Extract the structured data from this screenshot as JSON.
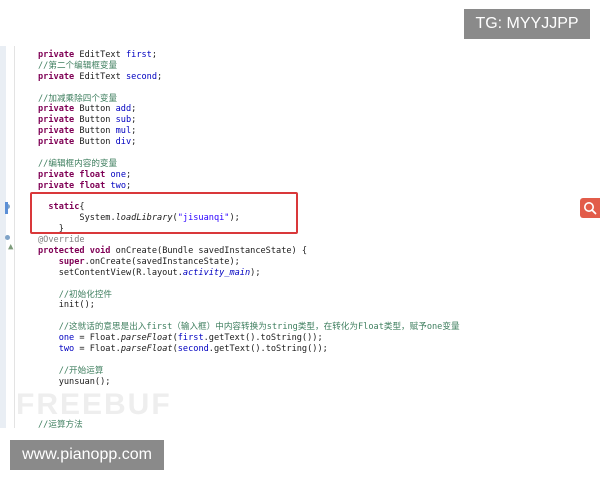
{
  "watermark_tg": "TG: MYYJJPP",
  "watermark_site": "www.pianopp.com",
  "watermark_logo": "FREEBUF",
  "colors": {
    "keyword": "#7f0055",
    "comment": "#3f7f5f",
    "field": "#0000c0",
    "string": "#2a00ff",
    "highlight_box": "#d9383a"
  },
  "code": {
    "l1": {
      "kw": "private",
      "type": " EditText ",
      "field": "first",
      "end": ";"
    },
    "c2": "//第二个编辑框变量",
    "l2": {
      "kw": "private",
      "type": " EditText ",
      "field": "second",
      "end": ";"
    },
    "c3": "//加减乘除四个变量",
    "buttons": [
      {
        "kw": "private",
        "type": " Button ",
        "field": "add",
        "end": ";"
      },
      {
        "kw": "private",
        "type": " Button ",
        "field": "sub",
        "end": ";"
      },
      {
        "kw": "private",
        "type": " Button ",
        "field": "mul",
        "end": ";"
      },
      {
        "kw": "private",
        "type": " Button ",
        "field": "div",
        "end": ";"
      }
    ],
    "c4": "//编辑框内容的变量",
    "floats": [
      {
        "kw1": "private",
        "kw2": "float",
        "field": "one",
        "end": ";"
      },
      {
        "kw1": "private",
        "kw2": "float",
        "field": "two",
        "end": ";"
      }
    ],
    "static_kw": "static",
    "static_open": "{",
    "load_pre": "System.",
    "load_method": "loadLibrary",
    "load_open": "(",
    "load_str": "\"jisuanqi\"",
    "load_close": ");",
    "static_close": "}",
    "override": "@Override",
    "oncreate": {
      "kw1": "protected",
      "kw2": "void",
      "rest": " onCreate(Bundle savedInstanceState) {"
    },
    "supercall": {
      "kw": "super",
      "rest": ".onCreate(savedInstanceState);"
    },
    "setcontent": {
      "pre": "setContentView(R.layout.",
      "it": "activity_main",
      "post": ");"
    },
    "c5": "//初始化控件",
    "init": "init();",
    "c6": "//这就话的意思是出入first（输入框）中内容转换为string类型，在转化为Float类型，赋予one变量",
    "parse1": {
      "field1": "one",
      "mid1": " = Float.",
      "method": "parseFloat",
      "mid2": "(",
      "field2": "first",
      "post": ".getText().toString());"
    },
    "parse2": {
      "field1": "two",
      "mid1": " = Float.",
      "method": "parseFloat",
      "mid2": "(",
      "field2": "second",
      "post": ".getText().toString());"
    },
    "c7": "//开始运算",
    "yunsuan": "yunsuan();",
    "close_brace": "}",
    "c8": "//运算方法"
  }
}
